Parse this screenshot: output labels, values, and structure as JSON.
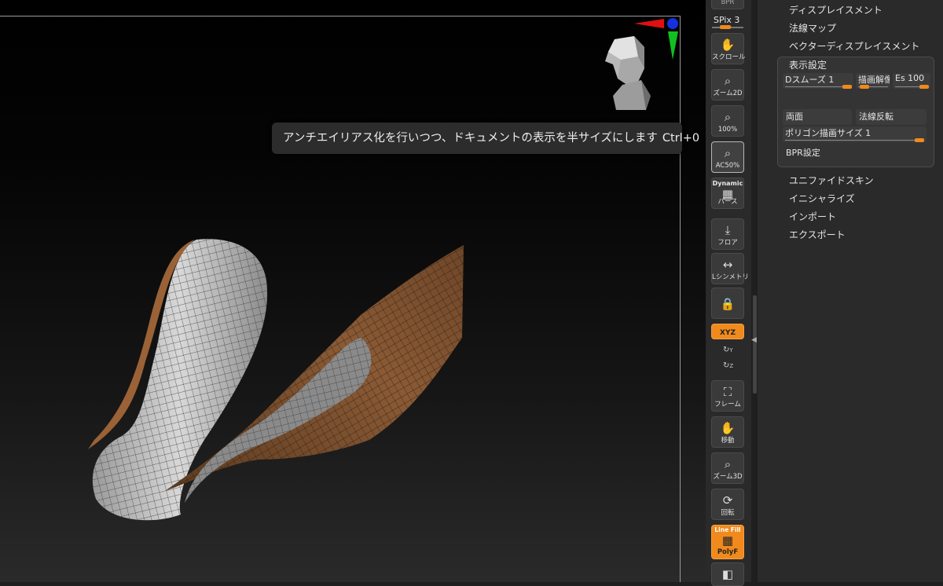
{
  "tooltip": {
    "text": "アンチエイリアス化を行いつつ、ドキュメントの表示を半サイズにします",
    "shortcut": "Ctrl+0"
  },
  "shelf": {
    "bpr": "BPR",
    "spix": "SPix 3",
    "scroll": "スクロール",
    "zoom2d": "ズーム2D",
    "pct100": "100%",
    "ac50": "AC50%",
    "dynamic": "Dynamic",
    "perspective": "パース",
    "floor": "フロア",
    "local_symmetry": "Lシンメトリ",
    "xyz": "XYZ",
    "y_label": "Y",
    "z_label": "Z",
    "frame": "フレーム",
    "move": "移動",
    "zoom3d": "ズーム3D",
    "rotate": "回転",
    "line_fill": "Line Fill",
    "polyf": "PolyF"
  },
  "palette": {
    "displacement": "ディスプレイスメント",
    "normal_map": "法線マップ",
    "vector_displacement": "ベクターディスプレイスメント",
    "display_properties": {
      "title": "表示設定",
      "dsmooth": "Dスムーズ 1",
      "draw_res": "描画解像",
      "es": "Es 100",
      "double": "両面",
      "flip_normals": "法線反転",
      "polygon_size": "ポリゴン描画サイズ 1",
      "bpr_settings": "BPR設定"
    },
    "unified_skin": "ユニファイドスキン",
    "initialize": "イニシャライズ",
    "import": "インポート",
    "export": "エクスポート"
  },
  "colors": {
    "accent": "#f08a1c",
    "panel": "#2a2a2a",
    "tooltip": "#2c2c2c"
  }
}
